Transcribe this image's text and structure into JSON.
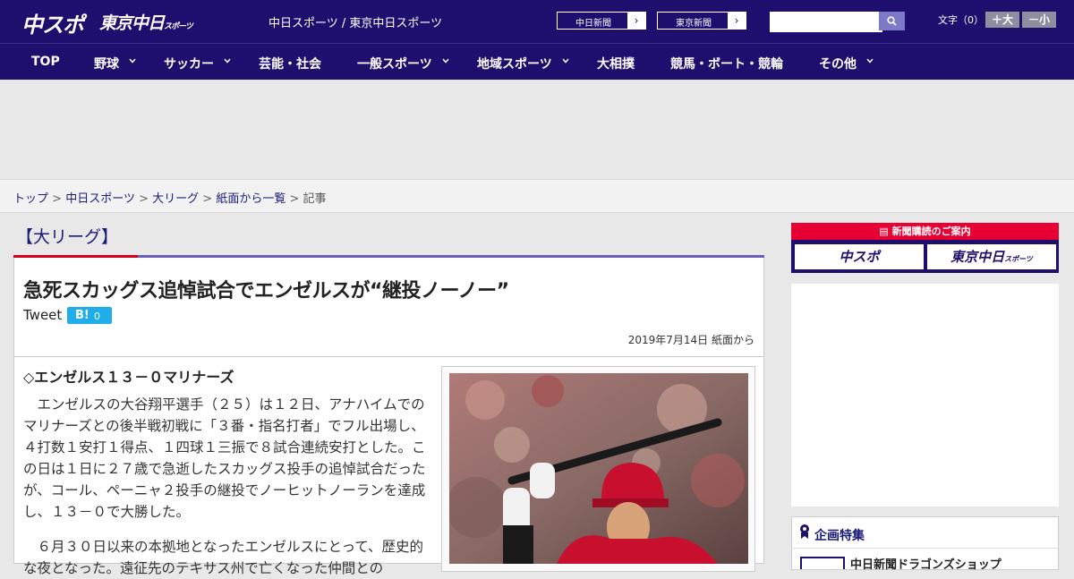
{
  "header": {
    "logo_chunichi": "中スポ",
    "logo_tokyo": "東京中日",
    "logo_tokyo_small": "スポーツ",
    "site_title": "中日スポーツ / 東京中日スポーツ",
    "paper_links": [
      {
        "label": "中日新聞",
        "arrow": "›"
      },
      {
        "label": "東京新聞",
        "arrow": "›"
      }
    ],
    "search_placeholder": "",
    "font_size_label": "文字（0）",
    "font_larger": "＋大",
    "font_smaller": "－小"
  },
  "nav": {
    "items": [
      {
        "label": "TOP",
        "has_menu": false
      },
      {
        "label": "野球",
        "has_menu": true
      },
      {
        "label": "サッカー",
        "has_menu": true
      },
      {
        "label": "芸能・社会",
        "has_menu": false
      },
      {
        "label": "一般スポーツ",
        "has_menu": true
      },
      {
        "label": "地域スポーツ",
        "has_menu": true
      },
      {
        "label": "大相撲",
        "has_menu": false
      },
      {
        "label": "競馬・ボート・競輪",
        "has_menu": false
      },
      {
        "label": "その他",
        "has_menu": true
      }
    ]
  },
  "breadcrumb": {
    "items": [
      "トップ",
      "中日スポーツ",
      "大リーグ",
      "紙面から一覧"
    ],
    "separator": ">",
    "current": "記事"
  },
  "article": {
    "category": "【大リーグ】",
    "headline": "急死スカッグス追悼試合でエンゼルスが“継投ノーノー”",
    "tweet_label": "Tweet",
    "hatena_label": "B!",
    "hatena_count": "0",
    "date": "2019年7月14日 紙面から",
    "subhead": "◇エンゼルス１３－０マリナーズ",
    "paragraphs": [
      "　エンゼルスの大谷翔平選手（２５）は１２日、アナハイムでのマリナーズとの後半戦初戦に「３番・指名打者」でフル出場し、４打数１安打１得点、１四球１三振で８試合連続安打とした。この日は１日に２７歳で急逝したスカッグス投手の追悼試合だったが、コール、ペーニャ２投手の継投でノーヒットノーランを達成し、１３－０で大勝した。",
      "　６月３０日以来の本拠地となったエンゼルスにとって、歴史的な夜となった。遠征先のテキサス州で亡くなった仲間との"
    ]
  },
  "sidebar": {
    "subscribe_title": "新聞購読のご案内",
    "subscribe_buttons": [
      "中スポ",
      "東京中日"
    ],
    "subscribe_small": "スポーツ",
    "feature_title": "企画特集",
    "feature_item": "中日新聞ドラゴンズショップ"
  },
  "colors": {
    "brand_navy": "#1e0f6e",
    "accent_red": "#d6001c",
    "link": "#1a1a7a",
    "hatena_blue": "#1faee9"
  }
}
